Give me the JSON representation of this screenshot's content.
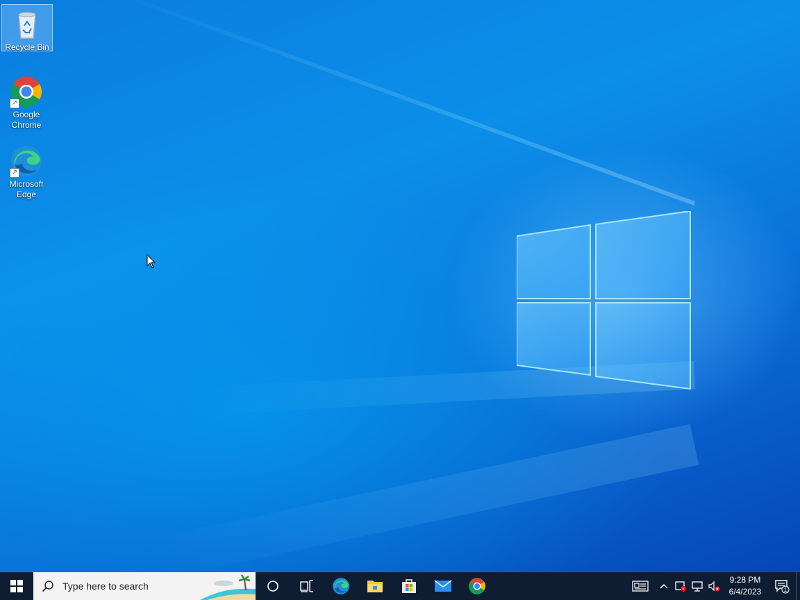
{
  "desktop": {
    "icons": [
      {
        "label": "Recycle Bin",
        "icon": "recycle-bin-icon"
      },
      {
        "label": "Google Chrome",
        "icon": "chrome-icon"
      },
      {
        "label": "Microsoft Edge",
        "icon": "edge-icon"
      }
    ]
  },
  "taskbar": {
    "search_placeholder": "Type here to search",
    "pinned": [
      {
        "name": "cortana",
        "icon": "cortana-icon"
      },
      {
        "name": "task-view",
        "icon": "task-view-icon"
      },
      {
        "name": "edge",
        "icon": "edge-icon"
      },
      {
        "name": "file-explorer",
        "icon": "folder-icon"
      },
      {
        "name": "microsoft-store",
        "icon": "store-icon"
      },
      {
        "name": "mail",
        "icon": "mail-icon"
      },
      {
        "name": "chrome",
        "icon": "chrome-icon"
      }
    ],
    "tray": {
      "time": "9:28 PM",
      "date": "6/4/2023",
      "notification_count": "1"
    }
  },
  "colors": {
    "taskbar_bg": "#0f1d33",
    "desktop_accent": "#0a7de0"
  }
}
